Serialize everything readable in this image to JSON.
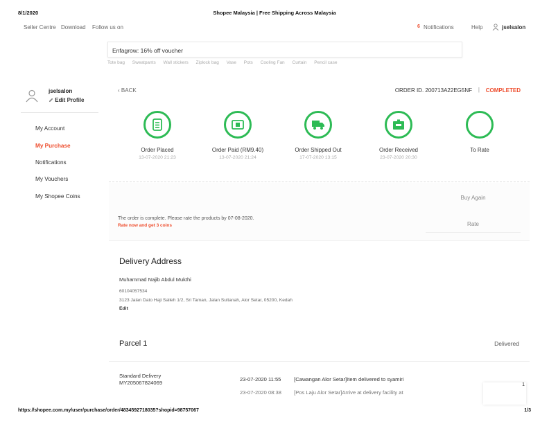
{
  "print": {
    "date": "8/1/2020",
    "title": "Shopee Malaysia | Free Shipping Across Malaysia",
    "url": "https://shopee.com.my/user/purchase/order/4834592718035?shopid=98757067",
    "page": "1/3"
  },
  "topnav": {
    "seller_centre": "Seller Centre",
    "download": "Download",
    "follow_us": "Follow us on",
    "notif_count": "6",
    "notifications": "Notifications",
    "help": "Help",
    "username": "jselsalon"
  },
  "search": {
    "value": "Enfagrow: 16% off voucher",
    "hints": [
      "Tote bag",
      "Sweatpants",
      "Wall stickers",
      "Ziplock bag",
      "Vase",
      "Pots",
      "Cooling Fan",
      "Curtain",
      "Pencil case"
    ]
  },
  "sidebar": {
    "username": "jselsalon",
    "edit_profile": "Edit Profile",
    "items": [
      {
        "label": "My Account"
      },
      {
        "label": "My Purchase"
      },
      {
        "label": "Notifications"
      },
      {
        "label": "My Vouchers"
      },
      {
        "label": "My Shopee Coins"
      }
    ]
  },
  "order": {
    "back": "BACK",
    "order_id": "ORDER ID. 200713A22EG5NF",
    "separator": "|",
    "status": "COMPLETED",
    "steps": [
      {
        "label": "Order Placed",
        "time": "13-07-2020 21:23",
        "icon": "receipt-icon"
      },
      {
        "label": "Order Paid (RM9.40)",
        "time": "13-07-2020 21:24",
        "icon": "money-icon"
      },
      {
        "label": "Order Shipped Out",
        "time": "17-07-2020 13:15",
        "icon": "truck-icon"
      },
      {
        "label": "Order Received",
        "time": "23-07-2020 20:30",
        "icon": "box-icon"
      },
      {
        "label": "To Rate",
        "time": "",
        "icon": "star-icon"
      }
    ],
    "buy_again": "Buy Again",
    "rate_msg": "The order is complete. Please rate the products by 07-08-2020.",
    "rate_coin": "Rate now and get 3 coins",
    "rate_button": "Rate"
  },
  "address": {
    "title": "Delivery Address",
    "name": "Muhammad Najib Abdul Mukthi",
    "phone": "60104057534",
    "line": "3123 Jalan Dato Haji Salleh 1/2, Sri Taman, Jalan Sultanah, Alor Setar, 05200, Kedah",
    "edit": "Edit"
  },
  "parcel": {
    "title": "Parcel 1",
    "status": "Delivered",
    "method": "Standard Delivery",
    "tracking_no": "MY205067824069",
    "events": [
      {
        "time": "23-07-2020 11:55",
        "text": "[Cawangan Alor Setar]Item delivered to syamiri"
      },
      {
        "time": "23-07-2020 08:38",
        "text": "[Pos Laju Alor Setar]Arrive at delivery facility at"
      }
    ],
    "float_num": "1"
  }
}
